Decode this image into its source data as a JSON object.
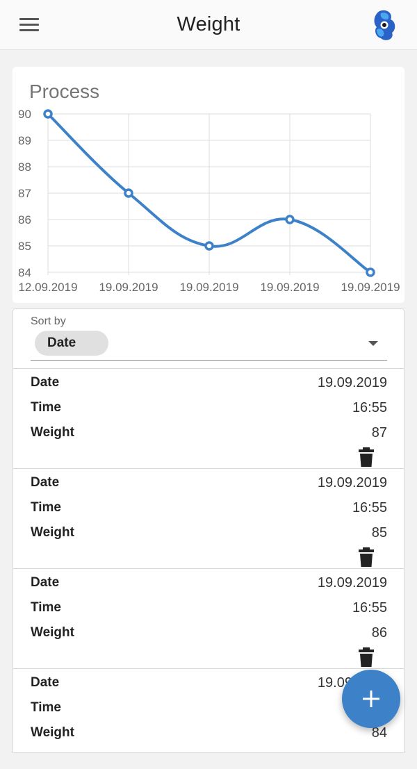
{
  "appbar": {
    "title": "Weight",
    "menu_icon": "hamburger-menu-icon",
    "logo_icon": "app-logo-icon"
  },
  "chart_data": {
    "type": "line",
    "title": "Process",
    "x": [
      "12.09.2019",
      "19.09.2019",
      "19.09.2019",
      "19.09.2019",
      "19.09.2019"
    ],
    "series": [
      {
        "values": [
          90,
          87,
          85,
          86,
          84
        ]
      }
    ],
    "ylim": [
      84,
      90
    ],
    "yticks": [
      90,
      89,
      88,
      87,
      86,
      85,
      84
    ],
    "grid": true,
    "color": "#3d82c8"
  },
  "sort": {
    "label": "Sort by",
    "selected": "Date"
  },
  "entries": [
    {
      "date_label": "Date",
      "date": "19.09.2019",
      "time_label": "Time",
      "time": "16:55",
      "weight_label": "Weight",
      "weight": "87"
    },
    {
      "date_label": "Date",
      "date": "19.09.2019",
      "time_label": "Time",
      "time": "16:55",
      "weight_label": "Weight",
      "weight": "85"
    },
    {
      "date_label": "Date",
      "date": "19.09.2019",
      "time_label": "Time",
      "time": "16:55",
      "weight_label": "Weight",
      "weight": "86"
    },
    {
      "date_label": "Date",
      "date": "19.09.2019",
      "time_label": "Time",
      "time": "",
      "weight_label": "Weight",
      "weight": "84"
    }
  ],
  "fab": {
    "icon": "plus-icon"
  },
  "colors": {
    "accent": "#3d82c8",
    "grid": "#dddddd"
  }
}
